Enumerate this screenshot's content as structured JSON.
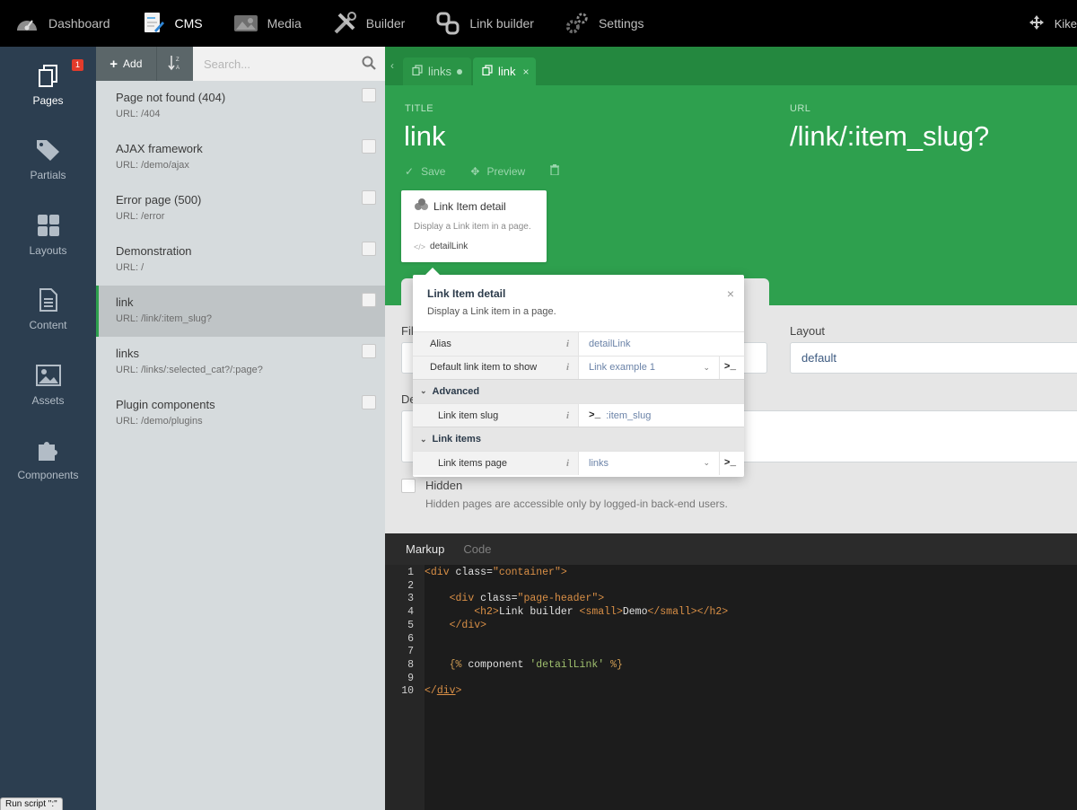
{
  "topbar": {
    "items": [
      {
        "label": "Dashboard",
        "icon": "dashboard-icon"
      },
      {
        "label": "CMS",
        "icon": "cms-icon"
      },
      {
        "label": "Media",
        "icon": "media-icon"
      },
      {
        "label": "Builder",
        "icon": "builder-icon"
      },
      {
        "label": "Link builder",
        "icon": "link-icon"
      },
      {
        "label": "Settings",
        "icon": "settings-icon"
      }
    ],
    "user": "Kike"
  },
  "sidenav": {
    "items": [
      {
        "label": "Pages",
        "badge": "1"
      },
      {
        "label": "Partials"
      },
      {
        "label": "Layouts"
      },
      {
        "label": "Content"
      },
      {
        "label": "Assets"
      },
      {
        "label": "Components"
      }
    ]
  },
  "pagelist": {
    "add_label": "Add",
    "search_placeholder": "Search...",
    "items": [
      {
        "title": "Page not found (404)",
        "url": "URL: /404"
      },
      {
        "title": "AJAX framework",
        "url": "URL: /demo/ajax"
      },
      {
        "title": "Error page (500)",
        "url": "URL: /error"
      },
      {
        "title": "Demonstration",
        "url": "URL: /"
      },
      {
        "title": "link",
        "url": "URL: /link/:item_slug?"
      },
      {
        "title": "links",
        "url": "URL: /links/:selected_cat?/:page?"
      },
      {
        "title": "Plugin components",
        "url": "URL: /demo/plugins"
      }
    ]
  },
  "editor": {
    "tabs": [
      {
        "label": "links"
      },
      {
        "label": "link"
      }
    ],
    "title_label": "TITLE",
    "title_value": "link",
    "url_label": "URL",
    "url_value": "/link/:item_slug?",
    "save_label": "Save",
    "preview_label": "Preview",
    "component_card": {
      "name": "Link Item detail",
      "description": "Display a Link item in a page.",
      "alias": "detailLink"
    },
    "file_label": "File",
    "layout_label": "Layout",
    "layout_value": "default",
    "description_label": "Description",
    "hidden_label": "Hidden",
    "hidden_help": "Hidden pages are accessible only by logged-in back-end users."
  },
  "popup": {
    "title": "Link Item detail",
    "description": "Display a Link item in a page.",
    "close": "×",
    "rows": {
      "alias_label": "Alias",
      "alias_value": "detailLink",
      "default_label": "Default link item to show",
      "default_value": "Link example 1",
      "advanced_group": "Advanced",
      "slug_label": "Link item slug",
      "slug_value": ":item_slug",
      "linkitems_group": "Link items",
      "page_label": "Link items page",
      "page_value": "links",
      "term": ">_"
    }
  },
  "code": {
    "tabs": [
      {
        "label": "Markup"
      },
      {
        "label": "Code"
      }
    ],
    "line_numbers": [
      "1",
      "2",
      "3",
      "4",
      "5",
      "6",
      "7",
      "8",
      "9",
      "10"
    ]
  },
  "status_text": "Run script \":\"",
  "colors": {
    "brand_green": "#2ea04e",
    "sidebar": "#2c3e50",
    "topbar": "#000000",
    "badge": "#e23b2b"
  }
}
